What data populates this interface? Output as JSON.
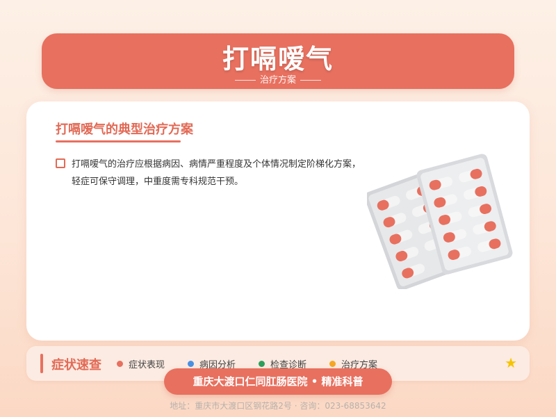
{
  "header": {
    "title": "打嗝嗳气",
    "subtitle": "治疗方案"
  },
  "main": {
    "heading": "打嗝嗳气的典型治疗方案",
    "body": "打嗝嗳气的治疗应根据病因、病情严重程度及个体情况制定阶梯化方案，轻症可保守调理，中重度需专科规范干预。",
    "illustration_icon": "pill-blister-pack-icon"
  },
  "quick_nav": {
    "title": "症状速查",
    "items": [
      {
        "label": "症状表现",
        "color": "#e8705f"
      },
      {
        "label": "病因分析",
        "color": "#4a90e2"
      },
      {
        "label": "检查诊断",
        "color": "#2e9e5b"
      },
      {
        "label": "治疗方案",
        "color": "#f5a623"
      }
    ],
    "star_icon": "star-icon",
    "star_color": "#f5c400"
  },
  "footer": {
    "hospital": "重庆大渡口仁同肛肠医院 • 精准科普",
    "address": "地址：重庆市大渡口区钢花路2号 · 咨询：023-68853642"
  },
  "colors": {
    "accent": "#e8705f",
    "heading": "#e26a56"
  }
}
